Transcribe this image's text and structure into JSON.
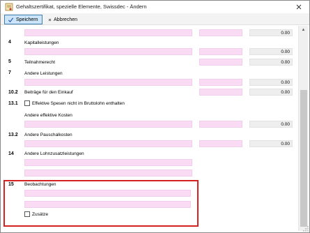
{
  "window": {
    "title": "Gehaltszertifikat, spezielle Elemente, Swissdec - Ändern",
    "close_symbol": "✕"
  },
  "toolbar": {
    "save_label": "Speichern",
    "cancel_label": "Abbrechen"
  },
  "icons": {
    "app": "certificate-icon",
    "save": "check-icon",
    "cancel": "x-icon"
  },
  "rows": {
    "top_value": "0.00",
    "r4": {
      "num": "4",
      "label": "Kapitalleistungen",
      "value": "0.00"
    },
    "r5": {
      "num": "5",
      "label": "Teilnahmerecht",
      "value": "0.00"
    },
    "r7": {
      "num": "7",
      "label": "Andere Leistungen",
      "value": "0.00"
    },
    "r7b_value": "0.00",
    "r10_2": {
      "num": "10.2",
      "label": "Beiträge für den Einkauf",
      "value": "0.00"
    },
    "r13_1": {
      "num": "13.1",
      "checkbox_label": "Effektive Spesen nicht im Bruttolohn enthalten"
    },
    "r13_1_other": {
      "label": "Andere effektive Kosten",
      "value": "0.00"
    },
    "r13_2": {
      "num": "13.2",
      "label": "Andere Pauschalkosten",
      "value": "0.00"
    },
    "r14": {
      "num": "14",
      "label": "Andere Lohnzusatzleistungen"
    },
    "r15": {
      "num": "15",
      "label": "Beobachtungen",
      "checkbox_label": "Zusätze"
    }
  },
  "colors": {
    "field_pink": "#f9dcf4",
    "readonly_gray": "#eeeeee",
    "highlight_red": "#d62121",
    "save_accent": "#3c7fb1"
  }
}
